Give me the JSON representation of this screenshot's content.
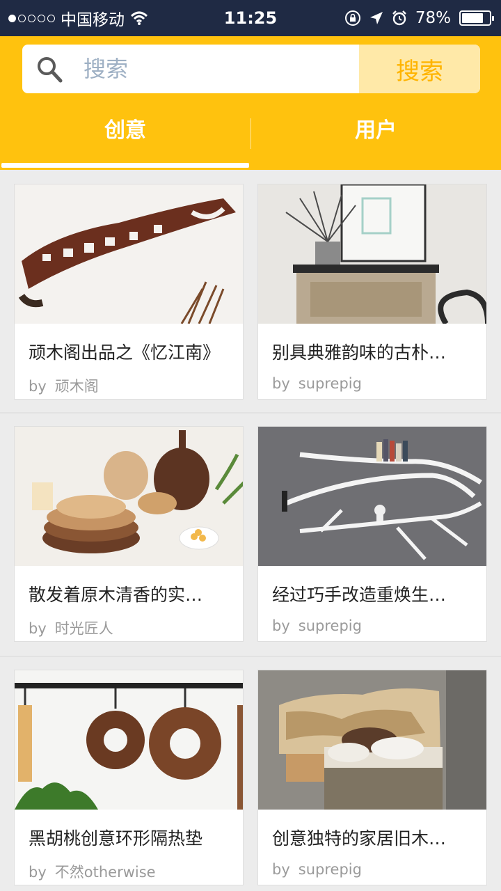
{
  "status_bar": {
    "carrier": "中国移动",
    "time": "11:25",
    "battery_text": "78%",
    "battery_level": 0.78,
    "icons": [
      "signal-dots-icon",
      "wifi-icon",
      "orientation-lock-icon",
      "location-arrow-icon",
      "alarm-icon",
      "battery-icon"
    ]
  },
  "search": {
    "placeholder": "搜索",
    "button_label": "搜索",
    "icon": "search-icon"
  },
  "tabs": [
    {
      "label": "创意",
      "active": true
    },
    {
      "label": "用户",
      "active": false
    }
  ],
  "colors": {
    "accent": "#ffc20e",
    "status_bar": "#1f2a44",
    "search_button_bg": "#ffe9a8",
    "search_button_text": "#ffb400"
  },
  "cards": [
    {
      "title": "顽木阁出品之《忆江南》",
      "by": "by",
      "author": "顽木阁"
    },
    {
      "title": "别具典雅韵味的古朴…",
      "by": "by",
      "author": "suprepig"
    },
    {
      "title": "散发着原木清香的实…",
      "by": "by",
      "author": "时光匠人"
    },
    {
      "title": "经过巧手改造重焕生…",
      "by": "by",
      "author": "suprepig"
    },
    {
      "title": "黑胡桃创意环形隔热垫",
      "by": "by",
      "author": "不然otherwise"
    },
    {
      "title": "创意独特的家居旧木…",
      "by": "by",
      "author": "suprepig"
    }
  ]
}
